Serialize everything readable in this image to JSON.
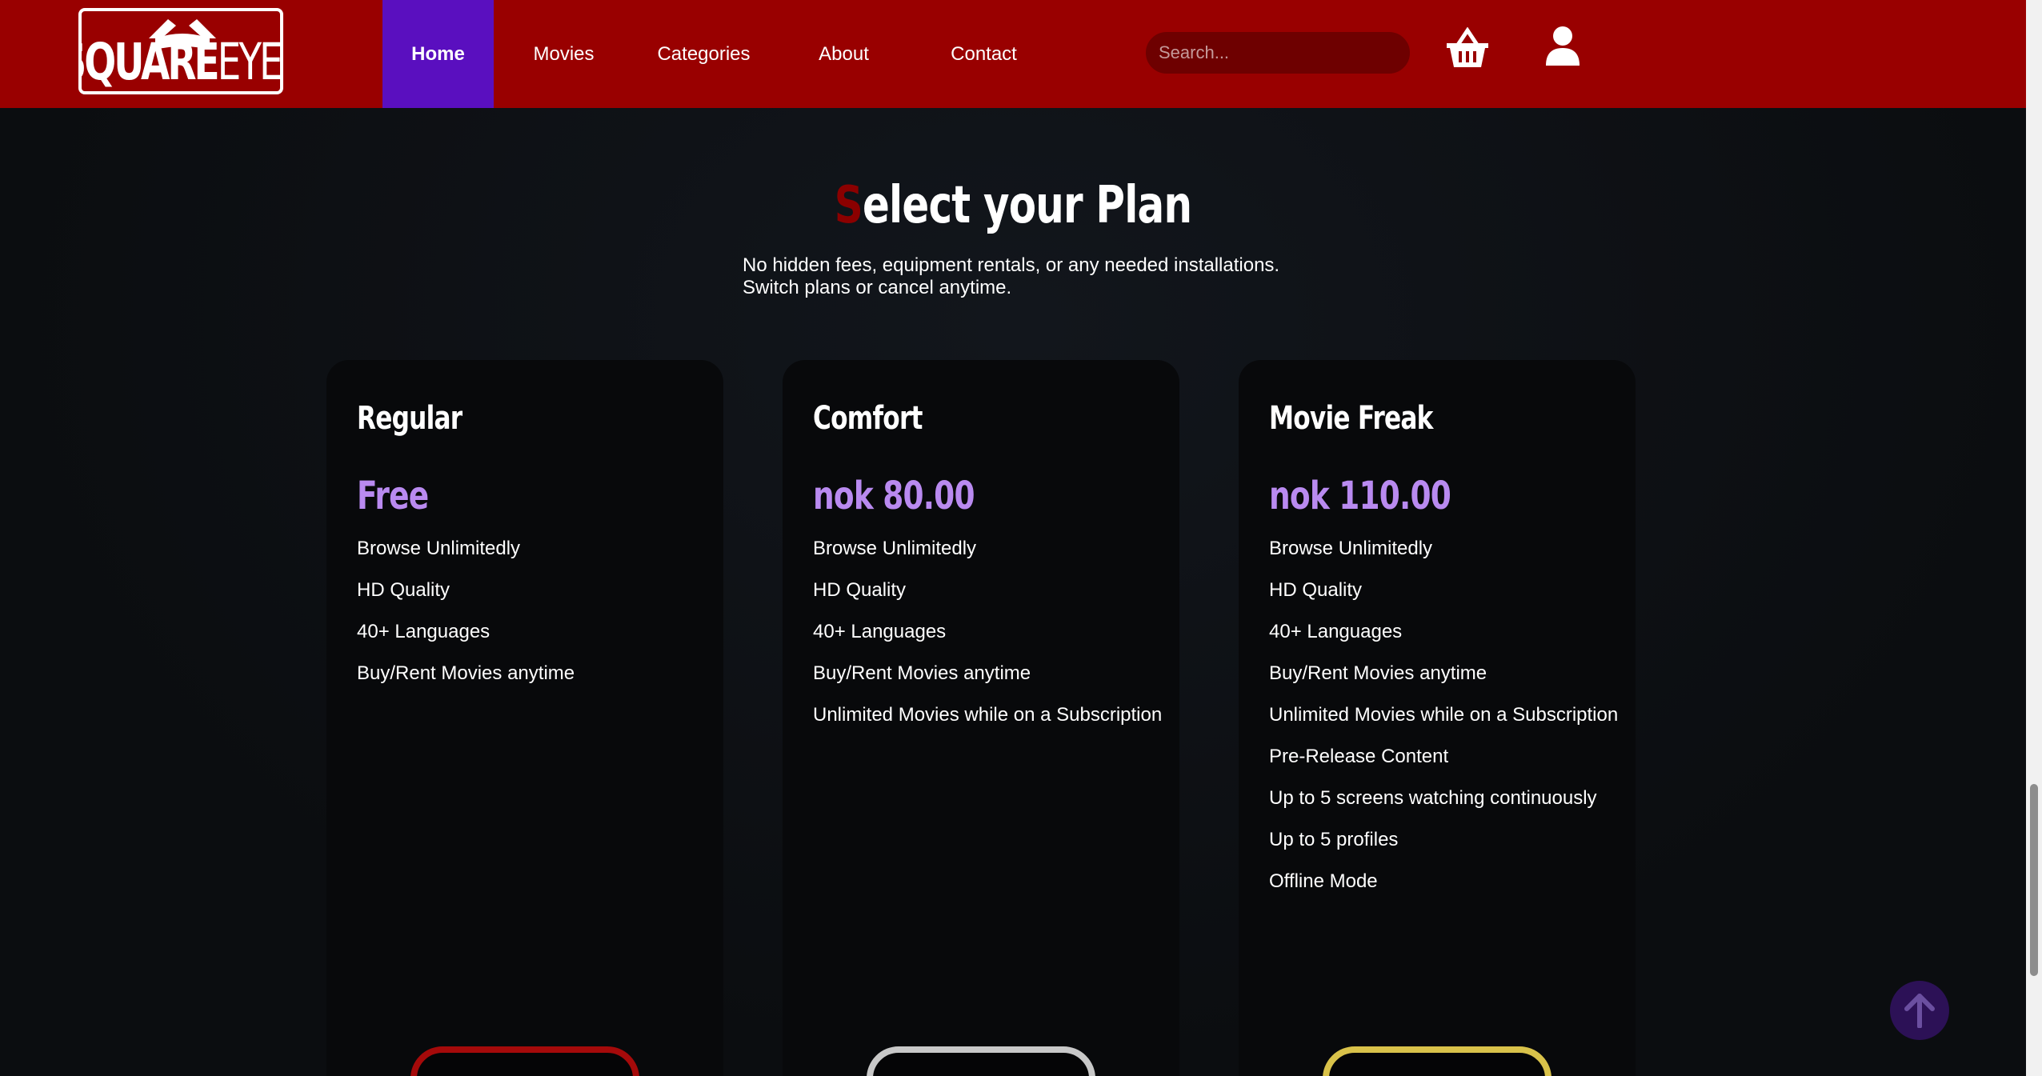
{
  "header": {
    "logo_text_bold": "SQUARE",
    "logo_text_light": "EYES",
    "nav": [
      "Home",
      "Movies",
      "Categories",
      "About",
      "Contact"
    ],
    "search_placeholder": "Search...",
    "colors": {
      "header_bg": "#990000",
      "active_nav": "#5a0fbf"
    },
    "icons": [
      "basket-icon",
      "user-icon"
    ]
  },
  "main": {
    "title_first_letter": "S",
    "title_rest": "elect your Plan",
    "subtitle_line1": "No hidden fees, equipment rentals, or any needed installations.",
    "subtitle_line2": "Switch plans or cancel anytime."
  },
  "plans": [
    {
      "name": "Regular",
      "price": "Free",
      "features": [
        "Browse Unlimitedly",
        "HD Quality",
        "40+ Languages",
        "Buy/Rent Movies anytime"
      ],
      "button_color": "#a50a0a"
    },
    {
      "name": "Comfort",
      "price": "nok 80.00",
      "features": [
        "Browse Unlimitedly",
        "HD Quality",
        "40+ Languages",
        "Buy/Rent Movies anytime",
        "Unlimited Movies while on a Subscription"
      ],
      "button_color": "#c8c8c8"
    },
    {
      "name": "Movie Freak",
      "price": "nok 110.00",
      "features": [
        "Browse Unlimitedly",
        "HD Quality",
        "40+ Languages",
        "Buy/Rent Movies anytime",
        "Unlimited Movies while on a Subscription",
        "Pre-Release Content",
        "Up to 5 screens watching continuously",
        "Up to 5 profiles",
        "Offline Mode"
      ],
      "button_color": "#d9c24a"
    }
  ],
  "scroll_top_icon": "arrow-up-icon"
}
